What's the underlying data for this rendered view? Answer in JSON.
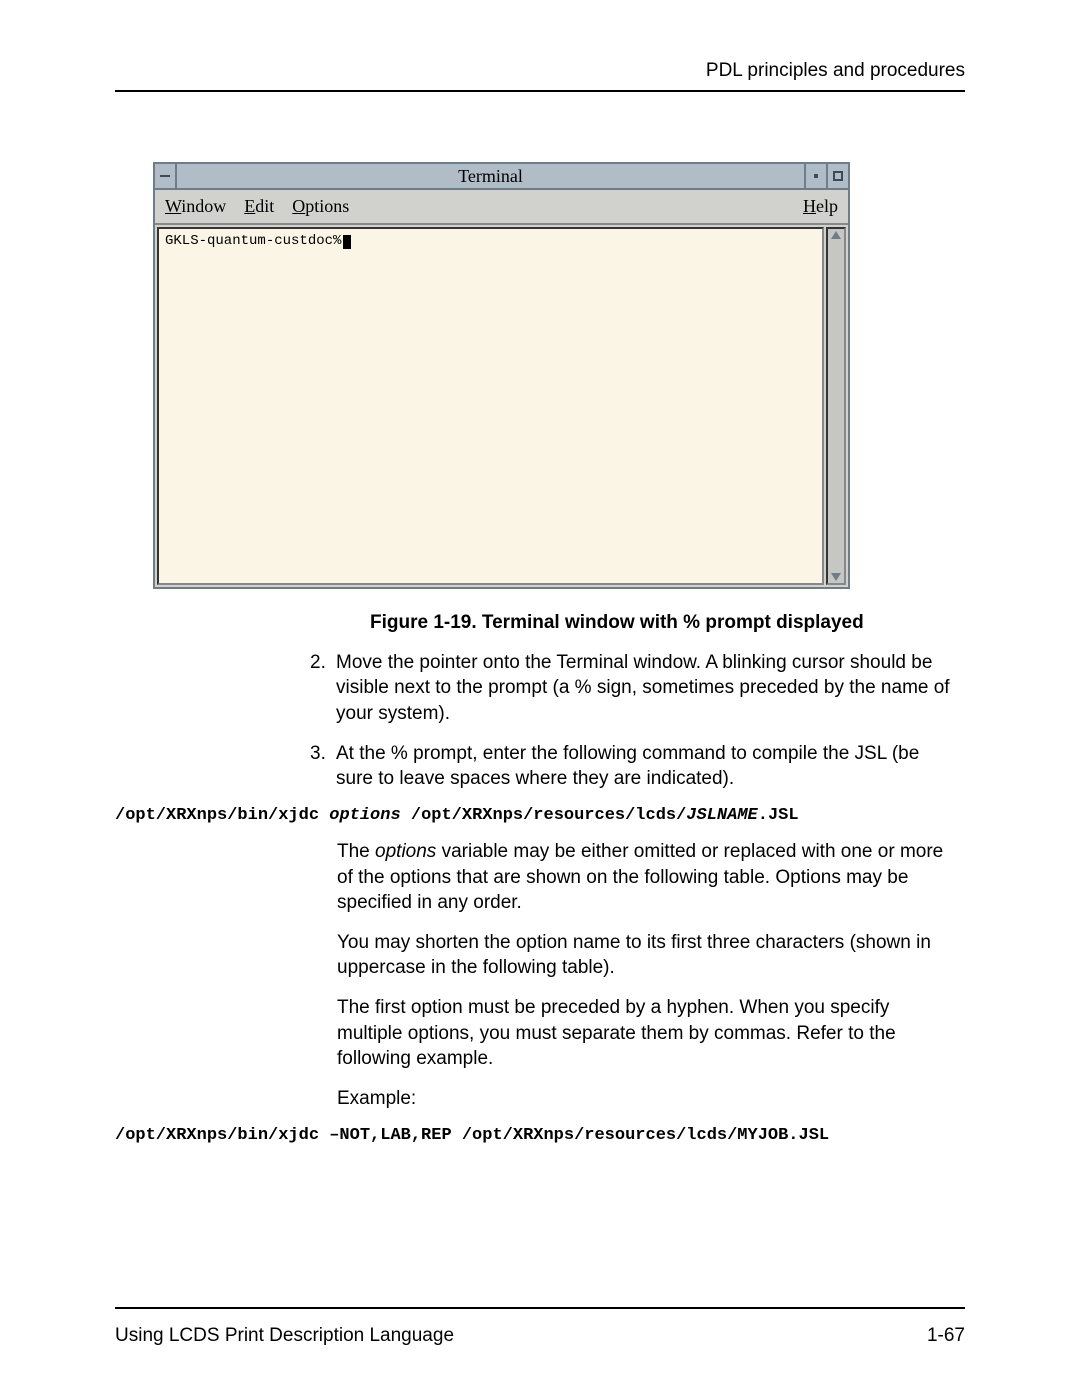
{
  "header": {
    "section_title": "PDL principles and procedures"
  },
  "terminal": {
    "title": "Terminal",
    "menu": {
      "window": "Window",
      "edit": "Edit",
      "options": "Options",
      "help": "Help"
    },
    "prompt_text": "GKLS-quantum-custdoc%"
  },
  "figure": {
    "caption": "Figure 1-19. Terminal window with % prompt displayed"
  },
  "steps": {
    "s2_num": "2.",
    "s2_text": "Move the pointer onto the Terminal window. A blinking cursor should be visible next to the prompt (a % sign, sometimes preceded by the name of your system).",
    "s3_num": "3.",
    "s3_text": "At the % prompt, enter the following command to compile the JSL (be sure to leave spaces where they are indicated)."
  },
  "code": {
    "line1_a": "/opt/XRXnps/bin/xjdc ",
    "line1_opts": "options",
    "line1_b": " /opt/XRXnps/resources/lcds/",
    "line1_name": "JSLNAME",
    "line1_c": ".JSL",
    "line2": "/opt/XRXnps/bin/xjdc –NOT,LAB,REP /opt/XRXnps/resources/lcds/MYJOB.JSL"
  },
  "paras": {
    "p1_a": "The ",
    "p1_ital": "options",
    "p1_b": " variable may be either omitted or replaced with one or more of the options that are shown on the following table. Options may be specified in any order.",
    "p2": "You may shorten the option name to its first three characters (shown in uppercase in the following table).",
    "p3": "The first option must be preceded by a hyphen. When you specify multiple options, you must separate them by commas. Refer to the following example.",
    "p4": "Example:"
  },
  "footer": {
    "left": "Using LCDS Print Description Language",
    "right": "1-67"
  }
}
